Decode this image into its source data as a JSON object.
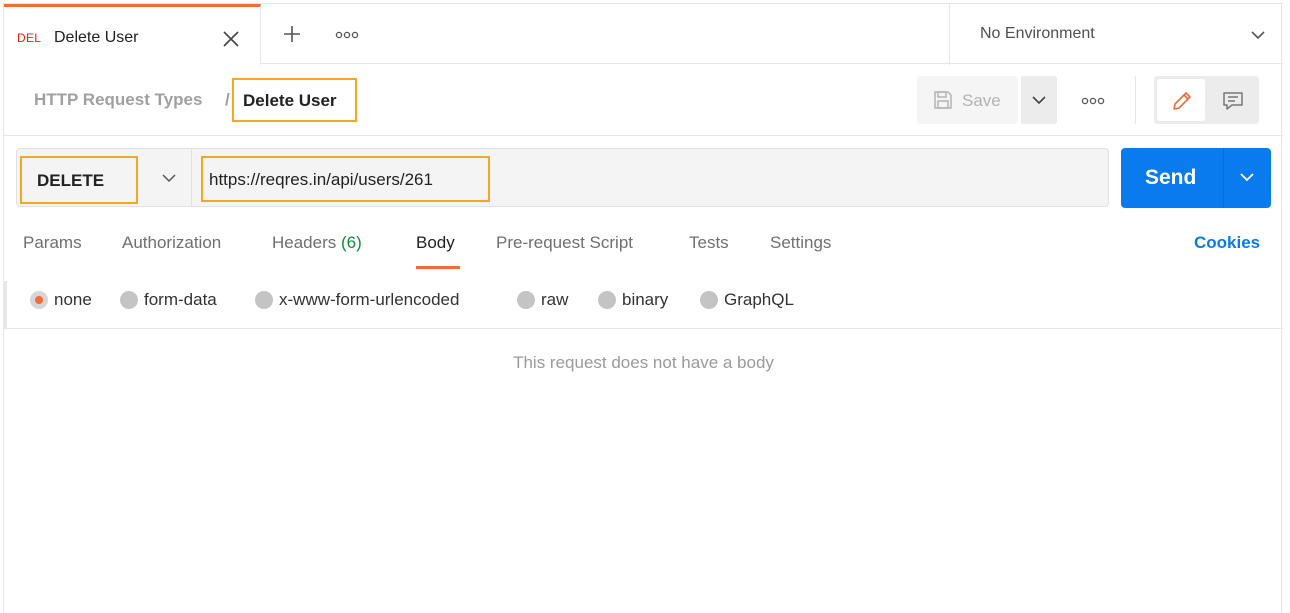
{
  "tab": {
    "method": "DEL",
    "name": "Delete User"
  },
  "environment": {
    "label": "No Environment"
  },
  "breadcrumb": {
    "parent": "HTTP Request Types",
    "separator": "/",
    "current": "Delete User"
  },
  "toolbar": {
    "save_label": "Save"
  },
  "request": {
    "method": "DELETE",
    "url": "https://reqres.in/api/users/261"
  },
  "send": {
    "label": "Send"
  },
  "request_tabs": {
    "params": "Params",
    "authorization": "Authorization",
    "headers": "Headers",
    "headers_count": "(6)",
    "body": "Body",
    "prerequest": "Pre-request Script",
    "tests": "Tests",
    "settings": "Settings",
    "active": "Body"
  },
  "cookies_label": "Cookies",
  "body_types": {
    "none": "none",
    "form_data": "form-data",
    "urlencoded": "x-www-form-urlencoded",
    "raw": "raw",
    "binary": "binary",
    "graphql": "GraphQL",
    "selected": "none"
  },
  "empty_message": "This request does not have a body",
  "colors": {
    "accent": "#f26b3a",
    "send": "#097bed",
    "highlight": "#f5a623",
    "delete_method": "#eb2013",
    "headers_count": "#0f8a3a"
  },
  "icons": [
    "close-icon",
    "plus-icon",
    "more-icon",
    "chevron-down-icon",
    "save-icon",
    "pencil-icon",
    "comment-icon"
  ]
}
